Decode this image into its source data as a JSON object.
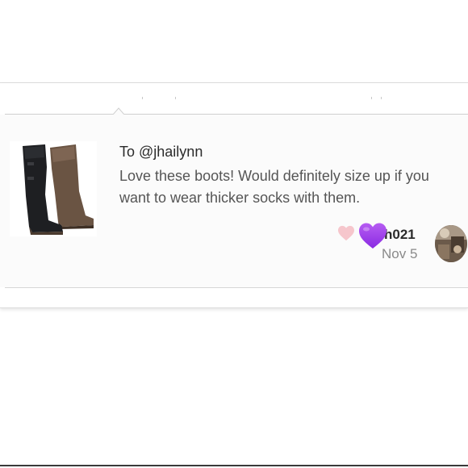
{
  "comment": {
    "to_line": "To @jhailynn",
    "text": "Love these boots! Would definitely size up if you want to wear thicker socks with them.",
    "username": "h021",
    "date": "Nov 5"
  },
  "icons": {
    "like": "heart-icon",
    "emoji": "purple-heart-emoji-icon",
    "caret": "caret-up-icon"
  },
  "colors": {
    "like_heart": "#f6c6cc",
    "emoji_heart": "#9b36e8",
    "text_primary": "#2b2b2b",
    "text_secondary": "#555555",
    "date": "#8a8a8a"
  }
}
